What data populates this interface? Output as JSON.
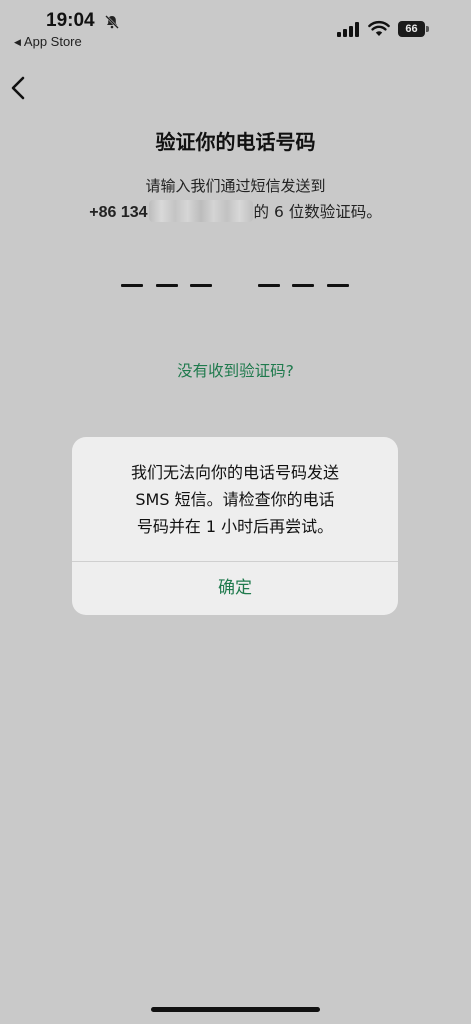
{
  "status_bar": {
    "time": "19:04",
    "back_to_app": "App Store",
    "battery": "66",
    "icons": [
      "bell-slash-icon",
      "cellular-signal-icon",
      "wifi-icon",
      "battery-icon"
    ]
  },
  "header": {
    "back_icon": "chevron-left-icon",
    "title": "验证你的电话号码",
    "subtitle": "请输入我们通过短信发送到",
    "phone_prefix": "+86 134",
    "phone_suffix": "的 6 位数验证码。"
  },
  "code_input": {
    "slots": 6,
    "values": [
      "",
      "",
      "",
      "",
      "",
      ""
    ]
  },
  "resend_link": "没有收到验证码?",
  "alert": {
    "line1": "我们无法向你的电话号码发送",
    "line2": "SMS 短信。请检查你的电话",
    "line3": "号码并在 1 小时后再尝试。",
    "ok_label": "确定"
  },
  "colors": {
    "background": "#c9c9c9",
    "accent": "#1f7a4d",
    "dialog": "#eeeeee"
  }
}
